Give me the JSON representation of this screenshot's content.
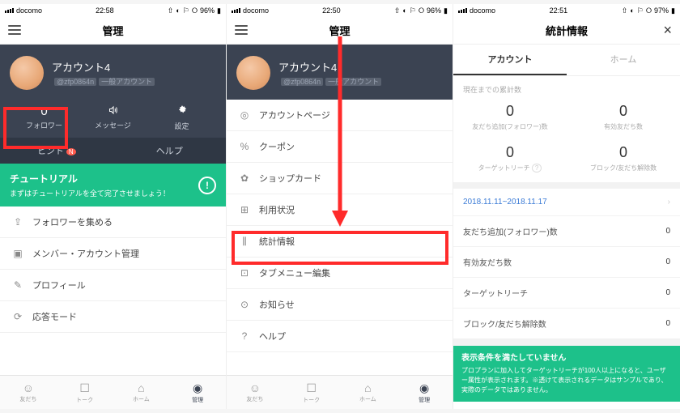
{
  "status": {
    "carrier": "docomo",
    "t1": "22:58",
    "t2": "22:50",
    "t3": "22:51",
    "b1": "96%",
    "b2": "96%",
    "b3": "97%"
  },
  "h": {
    "admin": "管理",
    "stats": "統計情報"
  },
  "profile": {
    "name": "アカウント4",
    "handle": "@zfp0864n",
    "type": "一般アカウント"
  },
  "tri": {
    "follower": "0",
    "follower_lbl": "フォロワー",
    "msg_lbl": "メッセージ",
    "set_lbl": "設定"
  },
  "two": {
    "hint": "ヒント",
    "help": "ヘルプ"
  },
  "tut": {
    "title": "チュートリアル",
    "sub": "まずはチュートリアルを全て完了させましょう！"
  },
  "menu1": [
    "フォロワーを集める",
    "メンバー・アカウント管理",
    "プロフィール",
    "応答モード"
  ],
  "menu2": [
    "アカウントページ",
    "クーポン",
    "ショップカード",
    "利用状況",
    "統計情報",
    "タブメニュー編集",
    "お知らせ",
    "ヘルプ"
  ],
  "menu2_ic": [
    "◎",
    "%",
    "✿",
    "⊞",
    "⫼",
    "⊡",
    "⊙",
    "?"
  ],
  "tabs": [
    {
      "ic": "☺",
      "lb": "友だち"
    },
    {
      "ic": "☐",
      "lb": "トーク"
    },
    {
      "ic": "⌂",
      "lb": "ホーム"
    },
    {
      "ic": "◉",
      "lb": "管理"
    }
  ],
  "stats_tabs": {
    "a": "アカウント",
    "b": "ホーム"
  },
  "stats": {
    "sect": "現在までの累計数",
    "c": [
      {
        "n": "0",
        "l": "友だち追加(フォロワー)数"
      },
      {
        "n": "0",
        "l": "有効友だち数"
      },
      {
        "n": "0",
        "l": "ターゲットリーチ"
      },
      {
        "n": "0",
        "l": "ブロック/友だち解除数"
      }
    ],
    "date": "2018.11.11~2018.11.17",
    "rows": [
      {
        "l": "友だち追加(フォロワー)数",
        "v": "0"
      },
      {
        "l": "有効友だち数",
        "v": "0"
      },
      {
        "l": "ターゲットリーチ",
        "v": "0"
      },
      {
        "l": "ブロック/友だち解除数",
        "v": "0"
      }
    ]
  },
  "banner": {
    "t": "表示条件を満たしていません",
    "b": "プロプランに加入してターゲットリーチが100人以上になると、ユーザー属性が表示されます。※透けて表示されるデータはサンプルであり、実際のデータではありません。"
  }
}
